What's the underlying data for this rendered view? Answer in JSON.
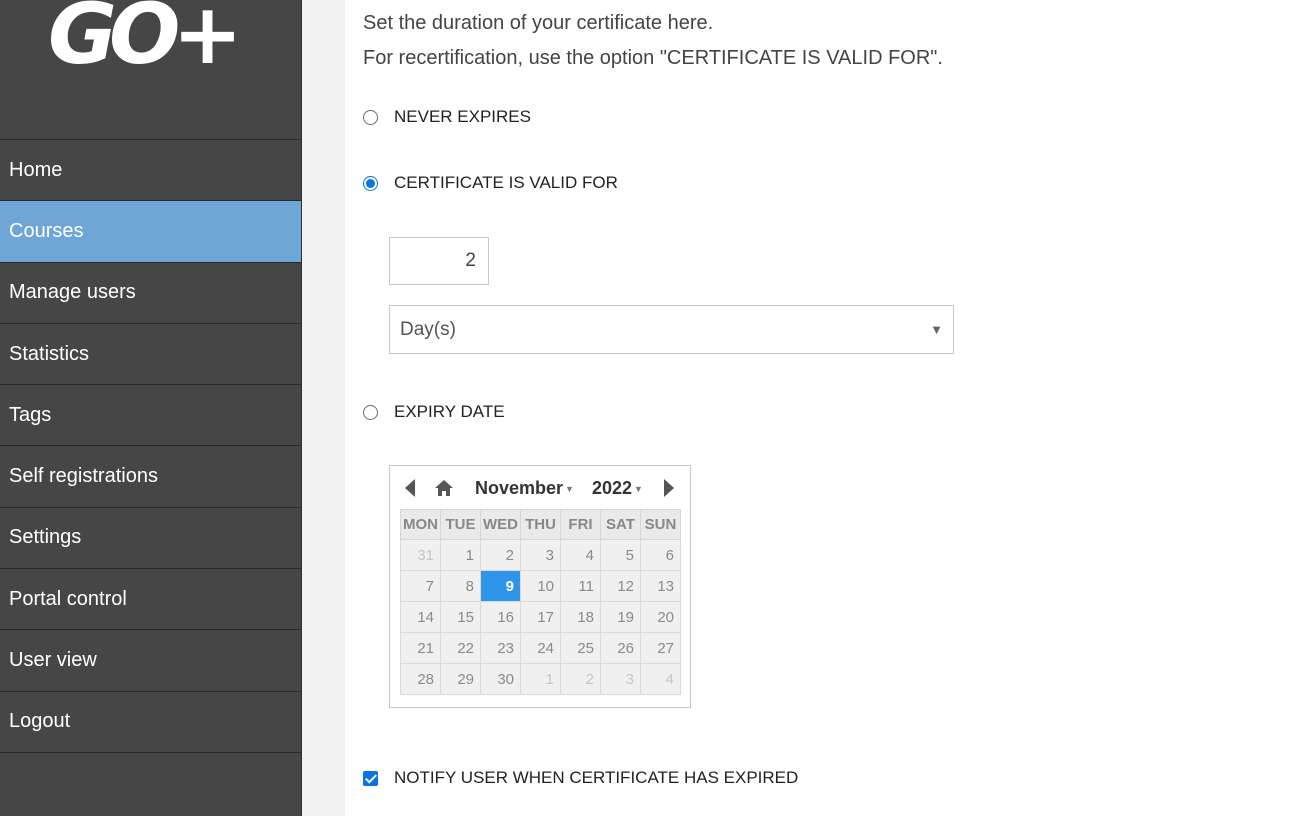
{
  "sidebar": {
    "logo_text": "GO+",
    "items": [
      {
        "label": "Home",
        "active": false
      },
      {
        "label": "Courses",
        "active": true
      },
      {
        "label": "Manage users",
        "active": false
      },
      {
        "label": "Statistics",
        "active": false
      },
      {
        "label": "Tags",
        "active": false
      },
      {
        "label": "Self registrations",
        "active": false
      },
      {
        "label": "Settings",
        "active": false
      },
      {
        "label": "Portal control",
        "active": false
      },
      {
        "label": "User view",
        "active": false
      },
      {
        "label": "Logout",
        "active": false
      }
    ],
    "active_color": "#6fa6d8",
    "background_color": "#464646"
  },
  "main": {
    "intro_line1": "Set the duration of your certificate here.",
    "intro_line2": "For recertification, use the option \"CERTIFICATE IS VALID FOR\".",
    "options": {
      "never_expires": {
        "label": "NEVER EXPIRES",
        "checked": false
      },
      "valid_for": {
        "label": "CERTIFICATE IS VALID FOR",
        "checked": true
      },
      "expiry_date": {
        "label": "EXPIRY DATE",
        "checked": false
      }
    },
    "duration_value": "2",
    "duration_unit": "Day(s)",
    "calendar": {
      "month": "November",
      "year": "2022",
      "weekdays": [
        "MON",
        "TUE",
        "WED",
        "THU",
        "FRI",
        "SAT",
        "SUN"
      ],
      "weeks": [
        [
          "31",
          "1",
          "2",
          "3",
          "4",
          "5",
          "6"
        ],
        [
          "7",
          "8",
          "9",
          "10",
          "11",
          "12",
          "13"
        ],
        [
          "14",
          "15",
          "16",
          "17",
          "18",
          "19",
          "20"
        ],
        [
          "21",
          "22",
          "23",
          "24",
          "25",
          "26",
          "27"
        ],
        [
          "28",
          "29",
          "30",
          "1",
          "2",
          "3",
          "4"
        ]
      ],
      "selected_day": "9",
      "selected_color": "#2f95e8"
    },
    "notify": {
      "label": "NOTIFY USER WHEN CERTIFICATE HAS EXPIRED",
      "checked": true
    }
  }
}
